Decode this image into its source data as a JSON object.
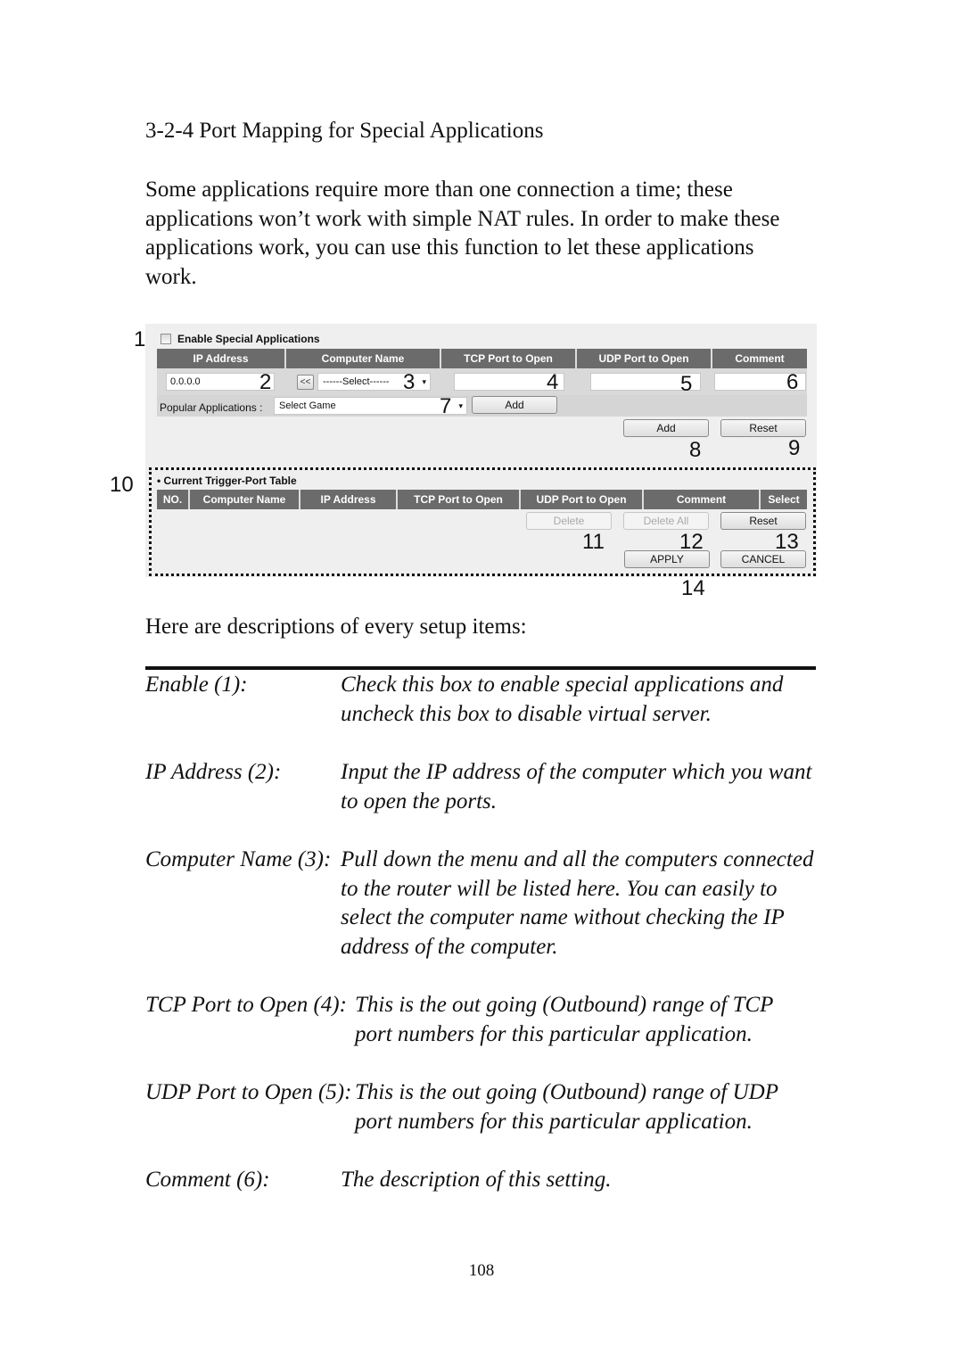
{
  "document": {
    "section_heading": "3-2-4 Port Mapping for Special Applications",
    "intro_paragraph": "Some applications require more than one connection a time; these applications won’t work with simple NAT rules. In order to make these applications work, you can use this function to let these applications work.",
    "descriptions_intro": "Here are descriptions of every setup items:",
    "page_number": "108"
  },
  "ui": {
    "enable_checkbox": {
      "label": "Enable Special Applications",
      "checked": false
    },
    "entry_table": {
      "headers": [
        "IP Address",
        "Computer Name",
        "TCP Port to Open",
        "UDP Port to Open",
        "Comment"
      ],
      "ip_address_value": "0.0.0.0",
      "copy_button_label": "<<",
      "computer_name_selected": "------Select------",
      "tcp_port_value": "",
      "udp_port_value": "",
      "comment_value": ""
    },
    "popular_apps": {
      "label": "Popular Applications :",
      "selected": "Select Game",
      "add_label": "Add"
    },
    "add_button_label": "Add",
    "reset_button_label": "Reset",
    "trigger_table": {
      "title": "Current Trigger-Port Table",
      "headers": [
        "NO.",
        "Computer Name",
        "IP Address",
        "TCP Port to Open",
        "UDP Port to Open",
        "Comment",
        "Select"
      ],
      "rows": []
    },
    "delete_label": "Delete",
    "delete_all_label": "Delete All",
    "table_reset_label": "Reset",
    "apply_label": "APPLY",
    "cancel_label": "CANCEL",
    "callouts": [
      "1",
      "2",
      "3",
      "4",
      "5",
      "6",
      "7",
      "8",
      "9",
      "10",
      "11",
      "12",
      "13",
      "14"
    ]
  },
  "descriptions": [
    {
      "term": "Enable (1):",
      "definition": "Check this box to enable special applications and uncheck this box to disable virtual server."
    },
    {
      "term": "IP Address (2):",
      "definition": "Input the IP address of the computer which you want to open the ports."
    },
    {
      "term": "Computer Name (3):",
      "definition": "Pull down the menu and all the computers connected to the router will be listed here. You can easily to select the computer name without checking the IP address of the computer."
    },
    {
      "term": "TCP Port to Open (4):",
      "definition": "This is the out going (Outbound) range of TCP port numbers for this particular application."
    },
    {
      "term": "UDP Port to Open (5):",
      "definition": "This is the out going (Outbound) range of UDP port numbers for this particular application."
    },
    {
      "term": "Comment (6):",
      "definition": "The description of this setting."
    }
  ]
}
